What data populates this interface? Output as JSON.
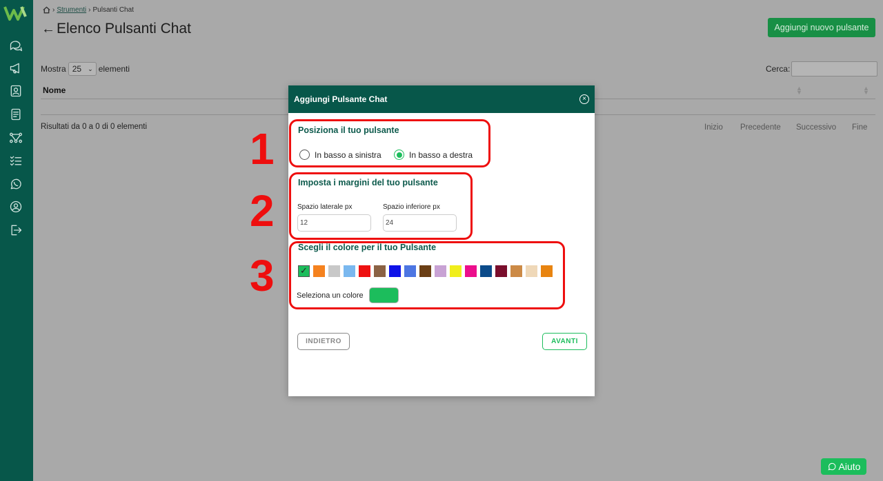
{
  "breadcrumb": {
    "parent": "Strumenti",
    "current": "Pulsanti Chat"
  },
  "page": {
    "title": "Elenco Pulsanti Chat",
    "add_button": "Aggiungi nuovo pulsante"
  },
  "table": {
    "show_label": "Mostra",
    "page_size": "25",
    "show_suffix": "elementi",
    "search_label": "Cerca:",
    "column_name": "Nome",
    "results_text": "Risultati da 0 a 0 di 0 elementi",
    "pager": [
      "Inizio",
      "Precedente",
      "Successivo",
      "Fine"
    ]
  },
  "sidebar": {
    "icons": [
      "chat-icon",
      "megaphone-icon",
      "contacts-icon",
      "document-icon",
      "flow-icon",
      "checklist-icon",
      "whatsapp-icon",
      "user-icon",
      "logout-icon"
    ]
  },
  "modal": {
    "title": "Aggiungi Pulsante Chat",
    "section1_title": "Posiziona il tuo pulsante",
    "radio_left": "In basso a sinistra",
    "radio_right": "In basso a destra",
    "selected_position": "In basso a destra",
    "section2_title": "Imposta i margini del tuo pulsante",
    "side_label": "Spazio laterale px",
    "side_value": "12",
    "bottom_label": "Spazio inferiore px",
    "bottom_value": "24",
    "section3_title": "Scegli il colore per il tuo Pulsante",
    "swatch_colors": [
      "#1cbd5c",
      "#f5821f",
      "#c8c8c8",
      "#7ab8ef",
      "#ee1111",
      "#8b6244",
      "#0f12e8",
      "#4d76e2",
      "#6b3f15",
      "#c8a2d4",
      "#f0ee1c",
      "#ec0e8c",
      "#0b4b8a",
      "#7a0e2c",
      "#cc8a46",
      "#efd8b8",
      "#e88410"
    ],
    "selected_color_index": 0,
    "pick_label": "Seleziona un colore",
    "picked_color": "#1cbd5c",
    "back_button": "INDIETRO",
    "next_button": "AVANTI"
  },
  "annotations": [
    "1",
    "2",
    "3"
  ],
  "help_button": "Aiuto"
}
